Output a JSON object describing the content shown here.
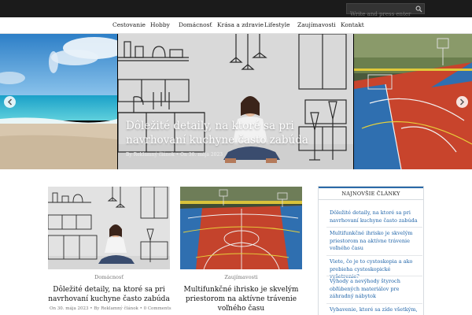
{
  "search": {
    "placeholder": "Write and press enter"
  },
  "nav": {
    "items": [
      "Cestovanie",
      "Hobby",
      "Domácnosť",
      "Krása a zdravie",
      "Lifestyle",
      "Zaujímavosti",
      "Kontakt"
    ]
  },
  "slider": {
    "title": "Dôležité detaily, na ktoré sa pri navrhovaní kuchyne často zabúda",
    "meta": "By Reklamný článok • On 30. mája 2023"
  },
  "posts": [
    {
      "category": "Domácnosť",
      "title": "Dôležité detaily, na ktoré sa pri navrhovaní kuchyne často zabúda",
      "meta": "On 30. mája 2023 • By Reklamný článok • 0 Comments"
    },
    {
      "category": "Zaujímavosti",
      "title": "Multifunkčné ihrisko je skvelým priestorom na aktívne trávenie voľného času"
    }
  ],
  "sidebar": {
    "title": "NAJNOVŠIE ČLÁNKY",
    "items": [
      "Dôležité detaily, na ktoré sa pri navrhovaní kuchyne často zabúda",
      "Multifunkčné ihrisko je skvelým priestorom na aktívne trávenie voľného času",
      "Viete, čo je to cystoskopia a ako prebieha cystoskopické vyšetrenie?",
      "Výhody a nevýhody štyroch obľúbených materiálov pre záhradný nábytok",
      "Vybavenie, ktoré sa zíde všetkým,"
    ]
  },
  "colors": {
    "topbar": "#1b1b1b",
    "accent": "#2b6aa8",
    "link": "#1e63a8"
  }
}
